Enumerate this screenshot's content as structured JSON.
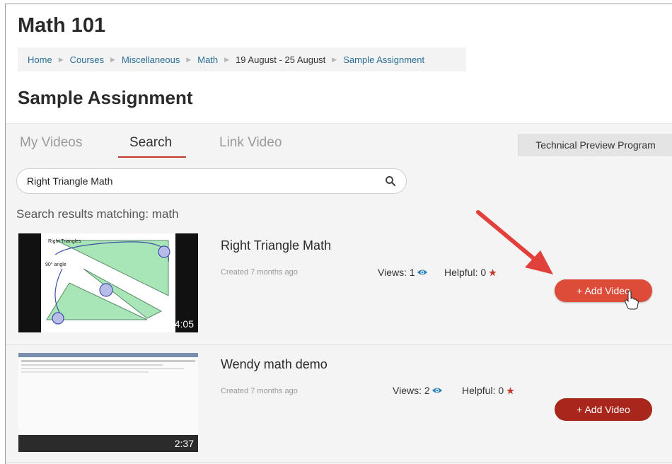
{
  "course": {
    "title": "Math 101"
  },
  "breadcrumb": [
    {
      "label": "Home"
    },
    {
      "label": "Courses"
    },
    {
      "label": "Miscellaneous"
    },
    {
      "label": "Math"
    },
    {
      "label": "19 August - 25 August"
    },
    {
      "label": "Sample Assignment"
    }
  ],
  "page": {
    "title": "Sample Assignment"
  },
  "tabs": [
    {
      "label": "My Videos",
      "active": false
    },
    {
      "label": "Search",
      "active": true
    },
    {
      "label": "Link Video",
      "active": false
    }
  ],
  "preview_button": {
    "label": "Technical Preview Program"
  },
  "search": {
    "value": "Right Triangle Math"
  },
  "results": {
    "label": "Search results matching: math",
    "items": [
      {
        "title": "Right Triangle Math",
        "created": "Created 7 months ago",
        "views": "Views: 1",
        "helpful": "Helpful: 0",
        "duration": "4:05",
        "add_label": "+ Add Video",
        "thumb_text_1": "Right Triangles",
        "thumb_text_2": "90° angle"
      },
      {
        "title": "Wendy math demo",
        "created": "Created 7 months ago",
        "views": "Views: 2",
        "helpful": "Helpful: 0",
        "duration": "2:37",
        "add_label": "+ Add Video"
      }
    ]
  },
  "colors": {
    "accent": "#c0392b",
    "link": "#2a6e96",
    "add_hover": "#dd4b39",
    "add_normal": "#a8261b",
    "arrow": "#e2403a",
    "eye": "#2a7fb8"
  },
  "icons": {
    "search": "search-icon",
    "eye": "eye-icon",
    "star": "star-icon",
    "cursor": "hand-pointer-icon",
    "arrow": "annotation-arrow-icon"
  }
}
